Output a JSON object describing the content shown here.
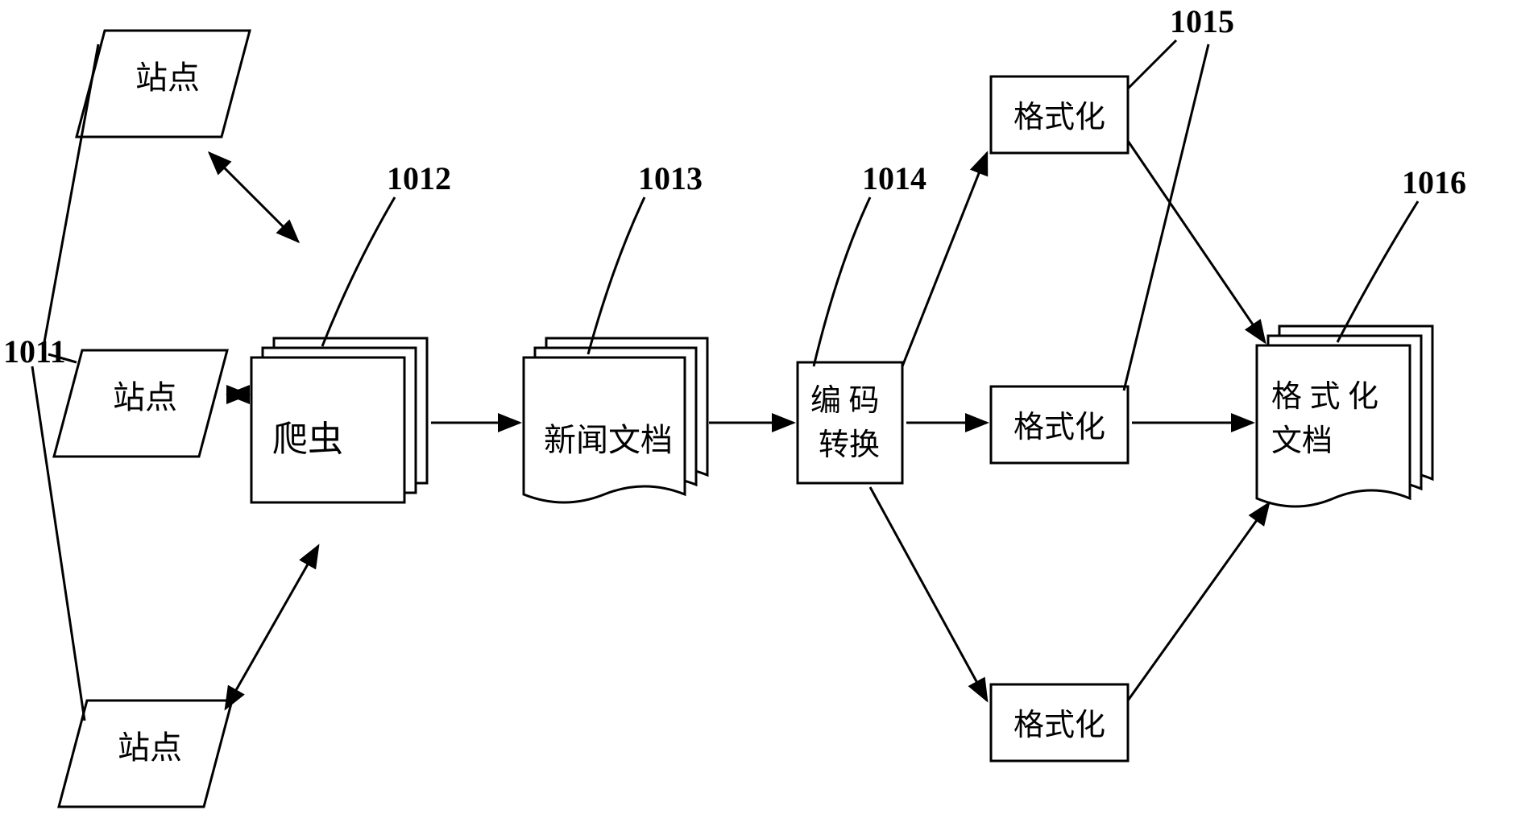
{
  "labels": {
    "ref1011": "1011",
    "ref1012": "1012",
    "ref1013": "1013",
    "ref1014": "1014",
    "ref1015": "1015",
    "ref1016": "1016"
  },
  "nodes": {
    "site_top": "站点",
    "site_mid": "站点",
    "site_bot": "站点",
    "crawler": "爬虫",
    "news_docs": "新闻文档",
    "encode_convert_line1": "编 码",
    "encode_convert_line2": "转换",
    "format_top": "格式化",
    "format_mid": "格式化",
    "format_bot": "格式化",
    "formatted_docs_line1": "格 式 化",
    "formatted_docs_line2": "文档"
  }
}
